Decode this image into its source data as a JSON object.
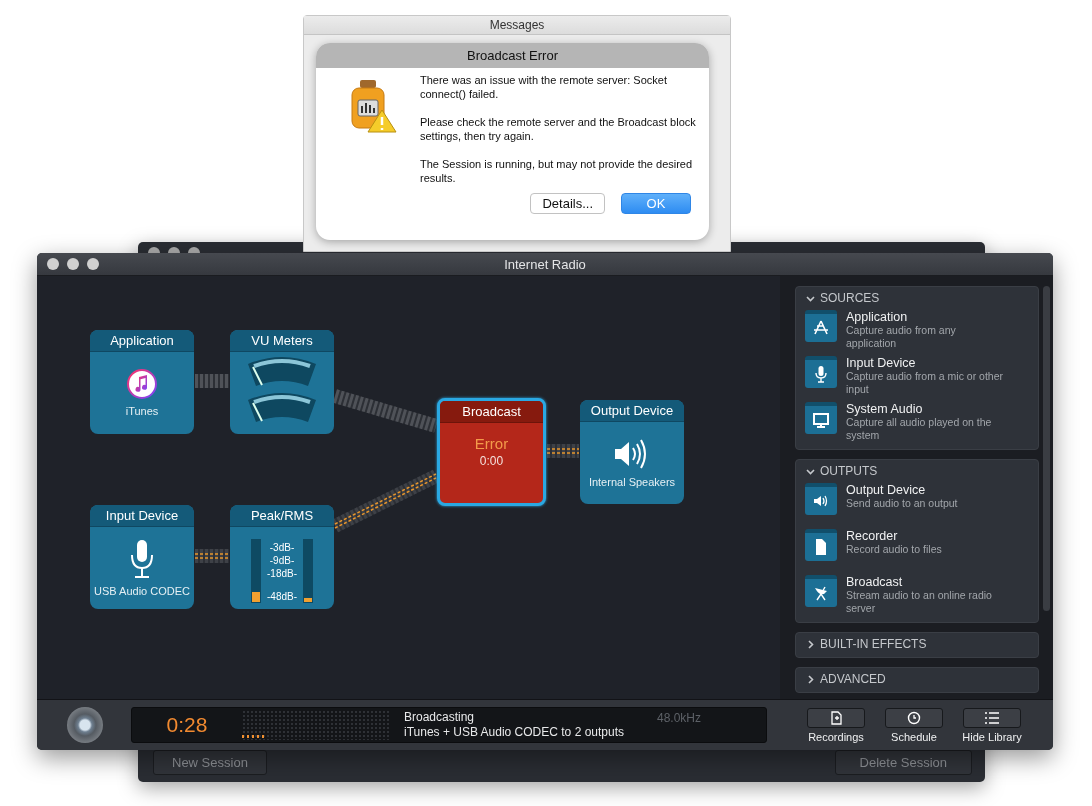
{
  "messages_window": {
    "title": "Messages",
    "alert": {
      "title": "Broadcast Error",
      "paragraphs": [
        "There was an issue with the remote server: Socket connect() failed.",
        "Please check the remote server and the Broadcast block settings, then try again.",
        "The Session is running, but may not provide the desired results."
      ],
      "buttons": [
        {
          "label": "Details...",
          "default": false
        },
        {
          "label": "OK",
          "default": true
        }
      ]
    }
  },
  "background_window": {
    "buttons": [
      "New Session",
      "Delete Session"
    ]
  },
  "window": {
    "title": "Internet Radio"
  },
  "nodes": [
    {
      "kind": "application",
      "title": "Application",
      "label": "iTunes"
    },
    {
      "kind": "vu",
      "title": "VU Meters"
    },
    {
      "kind": "broadcast",
      "title": "Broadcast",
      "status": "Error",
      "time": "0:00",
      "selected": true
    },
    {
      "kind": "output",
      "title": "Output Device",
      "label": "Internal Speakers"
    },
    {
      "kind": "input",
      "title": "Input Device",
      "label": "USB Audio CODEC"
    },
    {
      "kind": "peak",
      "title": "Peak/RMS",
      "scale": [
        "-3dB-",
        "-9dB-",
        "-18dB-",
        "-48dB-"
      ],
      "meters": [
        {
          "level": 0.15
        },
        {
          "level": 0.06
        }
      ]
    }
  ],
  "connections": [
    {
      "active": false
    },
    {
      "active": false
    },
    {
      "active": true
    },
    {
      "active": true
    },
    {
      "active": true
    }
  ],
  "sidebar": [
    {
      "title": "SOURCES",
      "expanded": true,
      "items": [
        {
          "kind": "app",
          "name": "Application",
          "description": "Capture audio from any application"
        },
        {
          "kind": "mic",
          "name": "Input Device",
          "description": "Capture audio from a mic or other input"
        },
        {
          "kind": "screen",
          "name": "System Audio",
          "description": "Capture all audio played on the system"
        }
      ]
    },
    {
      "title": "OUTPUTS",
      "expanded": true,
      "items": [
        {
          "kind": "speaker",
          "name": "Output Device",
          "description": "Send audio to an output"
        },
        {
          "kind": "file",
          "name": "Recorder",
          "description": "Record audio to files"
        },
        {
          "kind": "dish",
          "name": "Broadcast",
          "description": "Stream audio to an online radio server"
        }
      ]
    },
    {
      "title": "BUILT-IN EFFECTS",
      "expanded": false
    },
    {
      "title": "ADVANCED",
      "expanded": false
    }
  ],
  "status_bar": {
    "timer": "0:28",
    "status": "Broadcasting",
    "detail": "iTunes + USB Audio CODEC  to 2 outputs",
    "sample_rate": "48.0kHz",
    "buttons": [
      {
        "kind": "recordings",
        "label": "Recordings"
      },
      {
        "kind": "schedule",
        "label": "Schedule"
      },
      {
        "kind": "library",
        "label": "Hide Library"
      }
    ]
  }
}
